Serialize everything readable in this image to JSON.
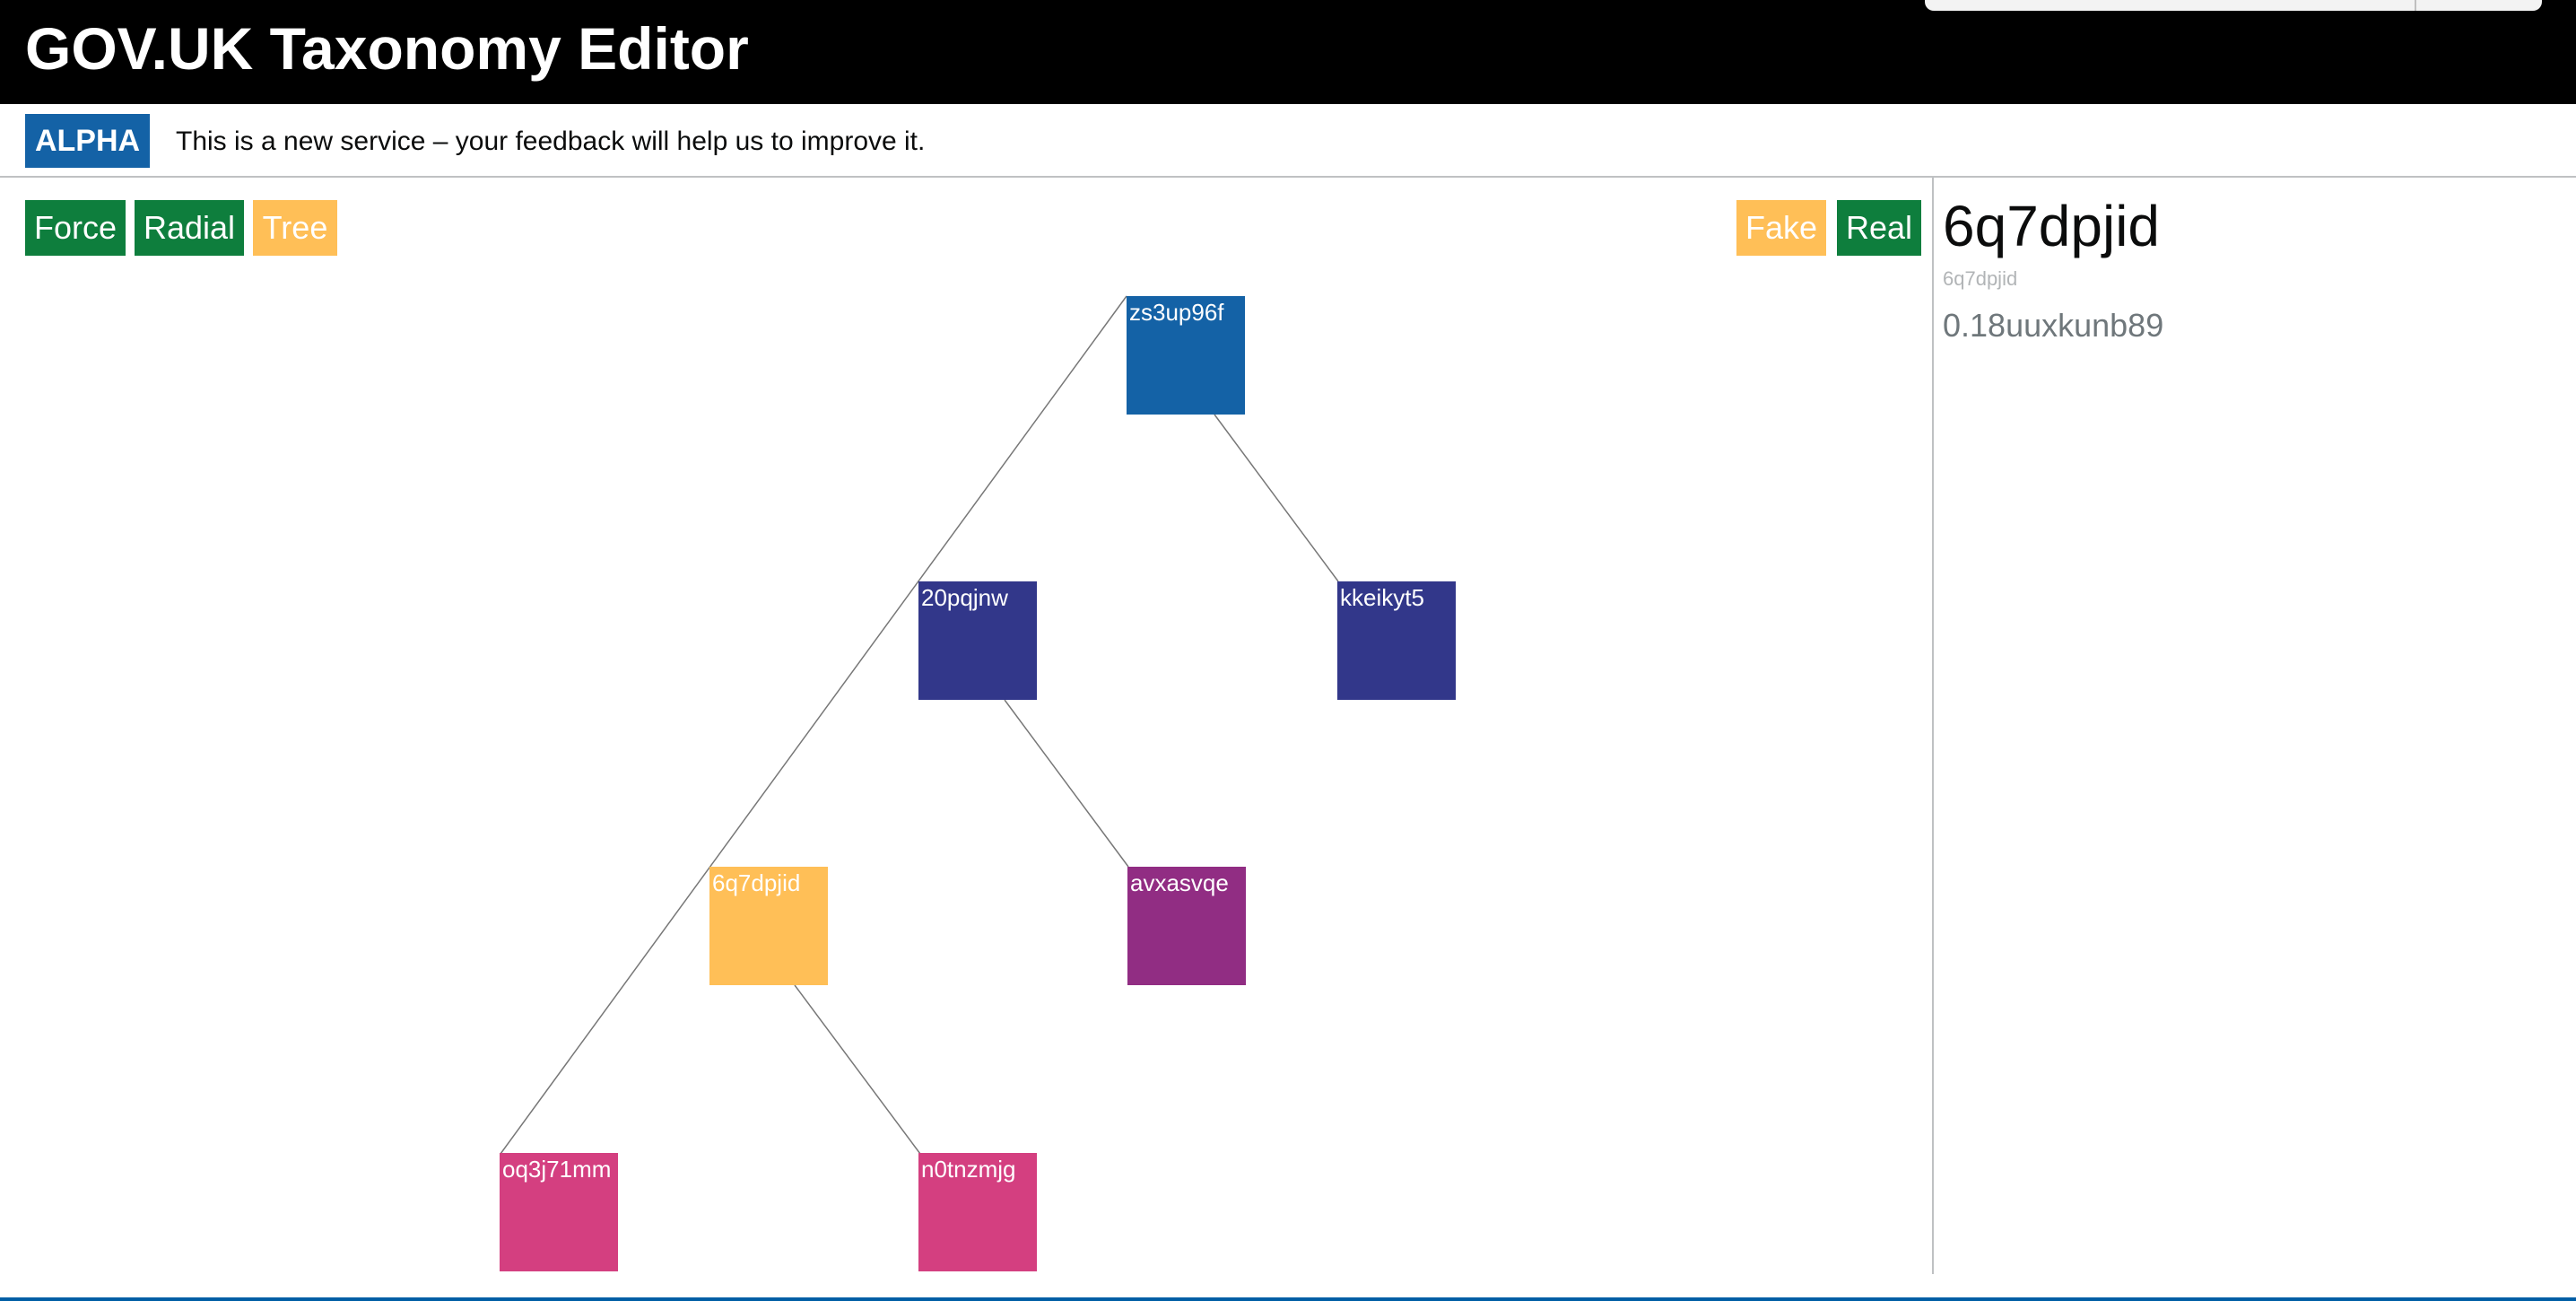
{
  "header": {
    "title": "GOV.UK Taxonomy Editor"
  },
  "phase_banner": {
    "tag": "ALPHA",
    "text": "This is a new service – your feedback will help us to improve it."
  },
  "layout_buttons": [
    {
      "label": "Force",
      "active": false
    },
    {
      "label": "Radial",
      "active": false
    },
    {
      "label": "Tree",
      "active": true
    }
  ],
  "data_source_buttons": [
    {
      "label": "Fake",
      "active": true
    },
    {
      "label": "Real",
      "active": false
    }
  ],
  "selected": {
    "title": "6q7dpjid",
    "id": "6q7dpjid",
    "value": "0.18uuxkunb89"
  },
  "tree": {
    "nodes": [
      {
        "label": "zs3up96f",
        "color": "#1462a6",
        "selected": false
      },
      {
        "label": "20pqjnw",
        "color": "#32378a",
        "selected": false
      },
      {
        "label": "kkeikyt5",
        "color": "#32378a",
        "selected": false
      },
      {
        "label": "6q7dpjid",
        "color": "#ffbf57",
        "selected": true
      },
      {
        "label": "avxasvqe",
        "color": "#912d83",
        "selected": false
      },
      {
        "label": "oq3j71mm",
        "color": "#d43f80",
        "selected": false
      },
      {
        "label": "n0tnzmjg",
        "color": "#d43f80",
        "selected": false
      }
    ]
  },
  "colors": {
    "header_bg": "#000000",
    "phase_tag": "#1462a6",
    "button_green": "#0e7e3d",
    "button_yellow": "#ffbf57",
    "link_line": "#777777"
  }
}
